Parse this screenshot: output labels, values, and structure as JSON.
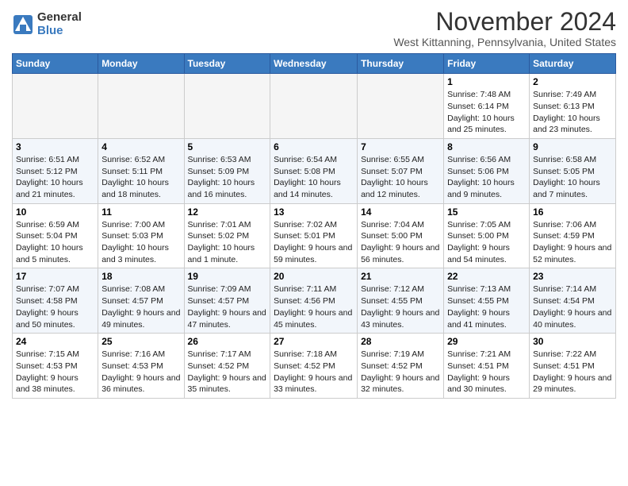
{
  "header": {
    "logo_general": "General",
    "logo_blue": "Blue",
    "month_title": "November 2024",
    "location": "West Kittanning, Pennsylvania, United States"
  },
  "days_of_week": [
    "Sunday",
    "Monday",
    "Tuesday",
    "Wednesday",
    "Thursday",
    "Friday",
    "Saturday"
  ],
  "weeks": [
    [
      {
        "day": "",
        "info": ""
      },
      {
        "day": "",
        "info": ""
      },
      {
        "day": "",
        "info": ""
      },
      {
        "day": "",
        "info": ""
      },
      {
        "day": "",
        "info": ""
      },
      {
        "day": "1",
        "info": "Sunrise: 7:48 AM\nSunset: 6:14 PM\nDaylight: 10 hours and 25 minutes."
      },
      {
        "day": "2",
        "info": "Sunrise: 7:49 AM\nSunset: 6:13 PM\nDaylight: 10 hours and 23 minutes."
      }
    ],
    [
      {
        "day": "3",
        "info": "Sunrise: 6:51 AM\nSunset: 5:12 PM\nDaylight: 10 hours and 21 minutes."
      },
      {
        "day": "4",
        "info": "Sunrise: 6:52 AM\nSunset: 5:11 PM\nDaylight: 10 hours and 18 minutes."
      },
      {
        "day": "5",
        "info": "Sunrise: 6:53 AM\nSunset: 5:09 PM\nDaylight: 10 hours and 16 minutes."
      },
      {
        "day": "6",
        "info": "Sunrise: 6:54 AM\nSunset: 5:08 PM\nDaylight: 10 hours and 14 minutes."
      },
      {
        "day": "7",
        "info": "Sunrise: 6:55 AM\nSunset: 5:07 PM\nDaylight: 10 hours and 12 minutes."
      },
      {
        "day": "8",
        "info": "Sunrise: 6:56 AM\nSunset: 5:06 PM\nDaylight: 10 hours and 9 minutes."
      },
      {
        "day": "9",
        "info": "Sunrise: 6:58 AM\nSunset: 5:05 PM\nDaylight: 10 hours and 7 minutes."
      }
    ],
    [
      {
        "day": "10",
        "info": "Sunrise: 6:59 AM\nSunset: 5:04 PM\nDaylight: 10 hours and 5 minutes."
      },
      {
        "day": "11",
        "info": "Sunrise: 7:00 AM\nSunset: 5:03 PM\nDaylight: 10 hours and 3 minutes."
      },
      {
        "day": "12",
        "info": "Sunrise: 7:01 AM\nSunset: 5:02 PM\nDaylight: 10 hours and 1 minute."
      },
      {
        "day": "13",
        "info": "Sunrise: 7:02 AM\nSunset: 5:01 PM\nDaylight: 9 hours and 59 minutes."
      },
      {
        "day": "14",
        "info": "Sunrise: 7:04 AM\nSunset: 5:00 PM\nDaylight: 9 hours and 56 minutes."
      },
      {
        "day": "15",
        "info": "Sunrise: 7:05 AM\nSunset: 5:00 PM\nDaylight: 9 hours and 54 minutes."
      },
      {
        "day": "16",
        "info": "Sunrise: 7:06 AM\nSunset: 4:59 PM\nDaylight: 9 hours and 52 minutes."
      }
    ],
    [
      {
        "day": "17",
        "info": "Sunrise: 7:07 AM\nSunset: 4:58 PM\nDaylight: 9 hours and 50 minutes."
      },
      {
        "day": "18",
        "info": "Sunrise: 7:08 AM\nSunset: 4:57 PM\nDaylight: 9 hours and 49 minutes."
      },
      {
        "day": "19",
        "info": "Sunrise: 7:09 AM\nSunset: 4:57 PM\nDaylight: 9 hours and 47 minutes."
      },
      {
        "day": "20",
        "info": "Sunrise: 7:11 AM\nSunset: 4:56 PM\nDaylight: 9 hours and 45 minutes."
      },
      {
        "day": "21",
        "info": "Sunrise: 7:12 AM\nSunset: 4:55 PM\nDaylight: 9 hours and 43 minutes."
      },
      {
        "day": "22",
        "info": "Sunrise: 7:13 AM\nSunset: 4:55 PM\nDaylight: 9 hours and 41 minutes."
      },
      {
        "day": "23",
        "info": "Sunrise: 7:14 AM\nSunset: 4:54 PM\nDaylight: 9 hours and 40 minutes."
      }
    ],
    [
      {
        "day": "24",
        "info": "Sunrise: 7:15 AM\nSunset: 4:53 PM\nDaylight: 9 hours and 38 minutes."
      },
      {
        "day": "25",
        "info": "Sunrise: 7:16 AM\nSunset: 4:53 PM\nDaylight: 9 hours and 36 minutes."
      },
      {
        "day": "26",
        "info": "Sunrise: 7:17 AM\nSunset: 4:52 PM\nDaylight: 9 hours and 35 minutes."
      },
      {
        "day": "27",
        "info": "Sunrise: 7:18 AM\nSunset: 4:52 PM\nDaylight: 9 hours and 33 minutes."
      },
      {
        "day": "28",
        "info": "Sunrise: 7:19 AM\nSunset: 4:52 PM\nDaylight: 9 hours and 32 minutes."
      },
      {
        "day": "29",
        "info": "Sunrise: 7:21 AM\nSunset: 4:51 PM\nDaylight: 9 hours and 30 minutes."
      },
      {
        "day": "30",
        "info": "Sunrise: 7:22 AM\nSunset: 4:51 PM\nDaylight: 9 hours and 29 minutes."
      }
    ]
  ]
}
